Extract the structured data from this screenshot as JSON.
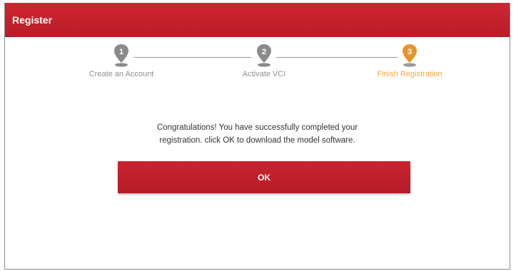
{
  "window": {
    "title": "Register"
  },
  "steps": [
    {
      "number": "1",
      "label": "Create an Account",
      "state": "done",
      "color": "#8a8a8a"
    },
    {
      "number": "2",
      "label": "Activate VCI",
      "state": "done",
      "color": "#8a8a8a"
    },
    {
      "number": "3",
      "label": "Finish Registration",
      "state": "active",
      "color": "#e8942e"
    }
  ],
  "message": {
    "line1": "Congratulations! You have successfully completed your",
    "line2": "registration. click OK to download the model software."
  },
  "ok_button": {
    "label": "OK"
  },
  "colors": {
    "brand_red": "#c0202b",
    "active_step": "#f3a53f",
    "inactive_step": "#8f8f8f"
  }
}
